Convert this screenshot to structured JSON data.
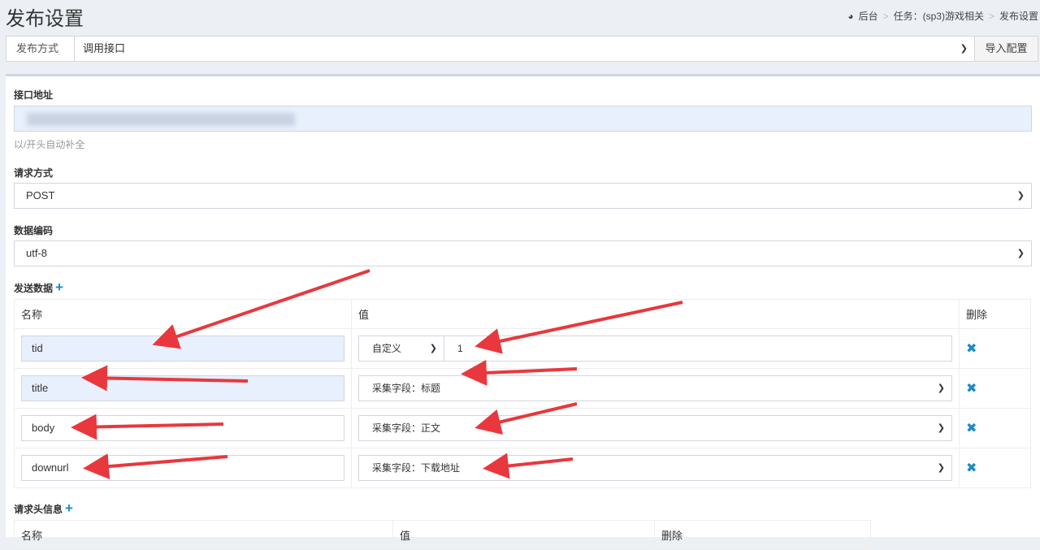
{
  "page_title": "发布设置",
  "breadcrumb": [
    "后台",
    "任务：(sp3)游戏相关",
    "发布设置"
  ],
  "publish": {
    "label": "发布方式",
    "value": "调用接口",
    "import_button": "导入配置"
  },
  "api": {
    "label": "接口地址",
    "hint": "以/开头自动补全"
  },
  "method": {
    "label": "请求方式",
    "value": "POST"
  },
  "encoding": {
    "label": "数据编码",
    "value": "utf-8"
  },
  "send_data": {
    "label": "发送数据",
    "headers": [
      "名称",
      "值",
      "删除"
    ],
    "rows": [
      {
        "name": "tid",
        "type": "自定义",
        "value": "1"
      },
      {
        "name": "title",
        "value": "采集字段：标题"
      },
      {
        "name": "body",
        "value": "采集字段：正文"
      },
      {
        "name": "downurl",
        "value": "采集字段：下载地址"
      }
    ]
  },
  "request_headers": {
    "label": "请求头信息",
    "headers": [
      "名称",
      "值",
      "删除"
    ]
  },
  "colors": {
    "accent": "#1a8bc6",
    "arrow": "#e8383d",
    "input_autofill": "#e8f0fe"
  }
}
